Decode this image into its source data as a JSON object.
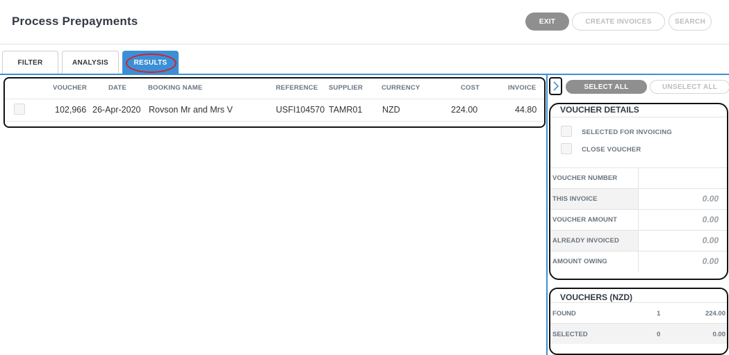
{
  "header": {
    "title": "Process Prepayments",
    "buttons": {
      "exit": "EXIT",
      "create_invoices": "CREATE INVOICES",
      "search": "SEARCH"
    }
  },
  "tabs": [
    {
      "label": "FILTER"
    },
    {
      "label": "ANALYSIS"
    },
    {
      "label": "RESULTS",
      "active": true
    }
  ],
  "results_table": {
    "columns": [
      "VOUCHER",
      "DATE",
      "BOOKING NAME",
      "REFERENCE",
      "SUPPLIER",
      "CURRENCY",
      "COST",
      "INVOICE"
    ],
    "rows": [
      {
        "selected": false,
        "voucher": "102,966",
        "date": "26-Apr-2020",
        "booking_name": "Rovson Mr and Mrs V",
        "reference": "USFI104570",
        "supplier": "TAMR01",
        "currency": "NZD",
        "cost": "224.00",
        "invoice": "44.80"
      }
    ]
  },
  "right_panel": {
    "expand_icon": "chevron-right-icon",
    "select_all": "SELECT ALL",
    "unselect_all": "UNSELECT ALL",
    "voucher_details": {
      "title": "VOUCHER DETAILS",
      "checkboxes": [
        {
          "label": "SELECTED FOR INVOICING",
          "checked": false
        },
        {
          "label": "CLOSE VOUCHER",
          "checked": false
        }
      ],
      "fields": [
        {
          "label": "VOUCHER NUMBER",
          "value": ""
        },
        {
          "label": "THIS INVOICE",
          "value": "0.00"
        },
        {
          "label": "VOUCHER AMOUNT",
          "value": "0.00"
        },
        {
          "label": "ALREADY INVOICED",
          "value": "0.00"
        },
        {
          "label": "AMOUNT OWING",
          "value": "0.00"
        }
      ]
    },
    "vouchers_summary": {
      "title": "VOUCHERS (NZD)",
      "rows": [
        {
          "label": "FOUND",
          "count": "1",
          "amount": "224.00"
        },
        {
          "label": "SELECTED",
          "count": "0",
          "amount": "0.00"
        }
      ]
    }
  },
  "colors": {
    "accent": "#3b8fd6",
    "highlight_ring": "#d4202a",
    "button_gray": "#8f8f8f"
  }
}
